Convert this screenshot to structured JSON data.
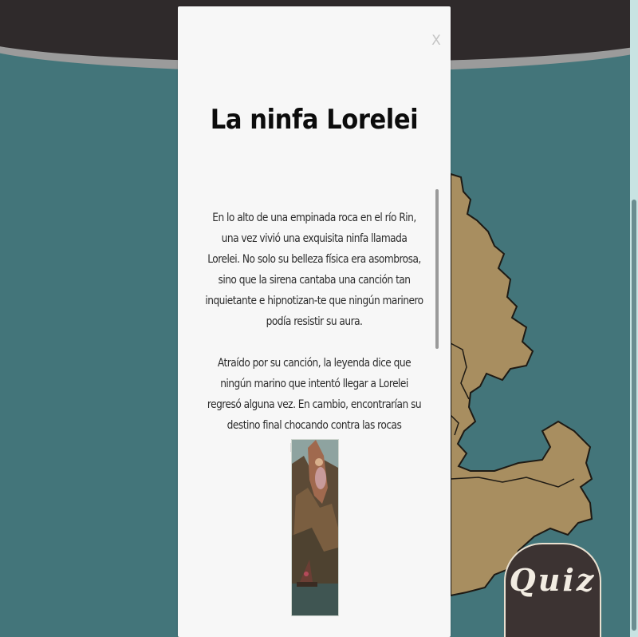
{
  "modal": {
    "close_label": "X",
    "title": "La ninfa Lorelei",
    "paragraphs": [
      "En lo alto de una empinada roca en el río Rin, una vez vivió una exquisita ninfa llamada Lorelei. No solo su belleza física era asombrosa, sino que la sirena cantaba una canción tan inquietante e hipnotizan-te que ningún marinero podía resistir su aura.",
      "Atraído por su canción, la leyenda dice que ningún marino que intentó llegar a Lorelei regresó alguna vez. En cambio, encontrarían su destino final chocando contra las rocas peligrosas."
    ],
    "image_icon": "lorelei-painting"
  },
  "quiz_button": {
    "label": "Quiz"
  },
  "colors": {
    "background": "#43757a",
    "banner": "#2f2a2b",
    "land": "#a88e60",
    "modal": "#f7f7f7",
    "quiz": "#3c3332"
  }
}
